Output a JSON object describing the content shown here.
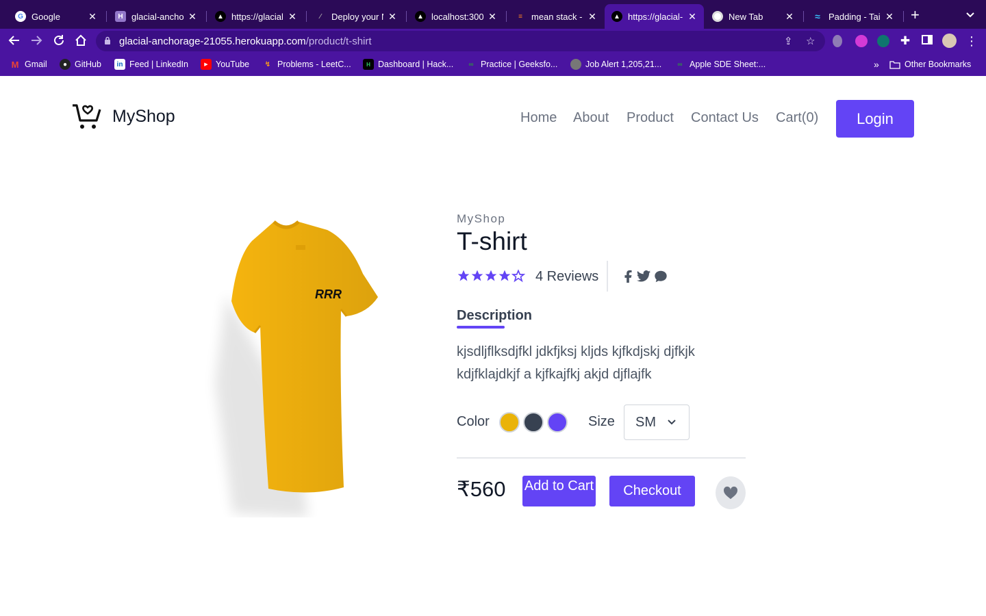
{
  "browser": {
    "tabs": [
      {
        "label": "Google",
        "icon": "google-icon"
      },
      {
        "label": "glacial-anchor",
        "icon": "heroku-icon"
      },
      {
        "label": "https://glacial-",
        "icon": "vercel-triangle-icon"
      },
      {
        "label": "Deploy your N",
        "icon": "code-icon"
      },
      {
        "label": "localhost:300",
        "icon": "vercel-triangle-icon"
      },
      {
        "label": "mean stack - ",
        "icon": "stackoverflow-icon"
      },
      {
        "label": "https://glacial-",
        "icon": "vercel-triangle-icon",
        "active": true
      },
      {
        "label": "New Tab",
        "icon": "chrome-icon"
      },
      {
        "label": "Padding - Tail",
        "icon": "tailwind-icon"
      }
    ],
    "url": {
      "host": "glacial-anchorage-21055.herokuapp.com",
      "path": "/product/t-shirt"
    },
    "bookmarks": [
      {
        "label": "Gmail",
        "icon": "gmail-icon"
      },
      {
        "label": "GitHub",
        "icon": "github-icon"
      },
      {
        "label": "Feed | LinkedIn",
        "icon": "linkedin-icon"
      },
      {
        "label": "YouTube",
        "icon": "youtube-icon"
      },
      {
        "label": "Problems - LeetC...",
        "icon": "leetcode-icon"
      },
      {
        "label": "Dashboard | Hack...",
        "icon": "hackerrank-icon"
      },
      {
        "label": "Practice | Geeksfo...",
        "icon": "gfg-icon"
      },
      {
        "label": "Job Alert 1,205,21...",
        "icon": "globe-icon"
      },
      {
        "label": "Apple SDE Sheet:...",
        "icon": "gfg-icon"
      }
    ],
    "bookmarks_more": "»",
    "other_bookmarks": "Other Bookmarks"
  },
  "site": {
    "brand": "MyShop",
    "nav": [
      "Home",
      "About",
      "Product",
      "Contact Us",
      "Cart(0)"
    ],
    "login_label": "Login"
  },
  "product": {
    "brand": "MyShop",
    "title": "T-shirt",
    "rating": 4,
    "rating_max": 5,
    "reviews": "4 Reviews",
    "description_heading": "Description",
    "description": "kjsdljflksdjfkl jdkfjksj kljds kjfkdjskj djfkjk kdjfklajdkjf a kjfkajfkj akjd djflajfk",
    "color_label": "Color",
    "colors": [
      "#eab308",
      "#374151",
      "#6344f5"
    ],
    "size_label": "Size",
    "size_selected": "SM",
    "price": "₹560",
    "add_to_cart": "Add to Cart",
    "checkout": "Checkout",
    "shirt_print": "RRR"
  },
  "colors": {
    "accent": "#6344f5",
    "chrome_dark": "#2b0a57",
    "chrome": "#4a14a0"
  }
}
